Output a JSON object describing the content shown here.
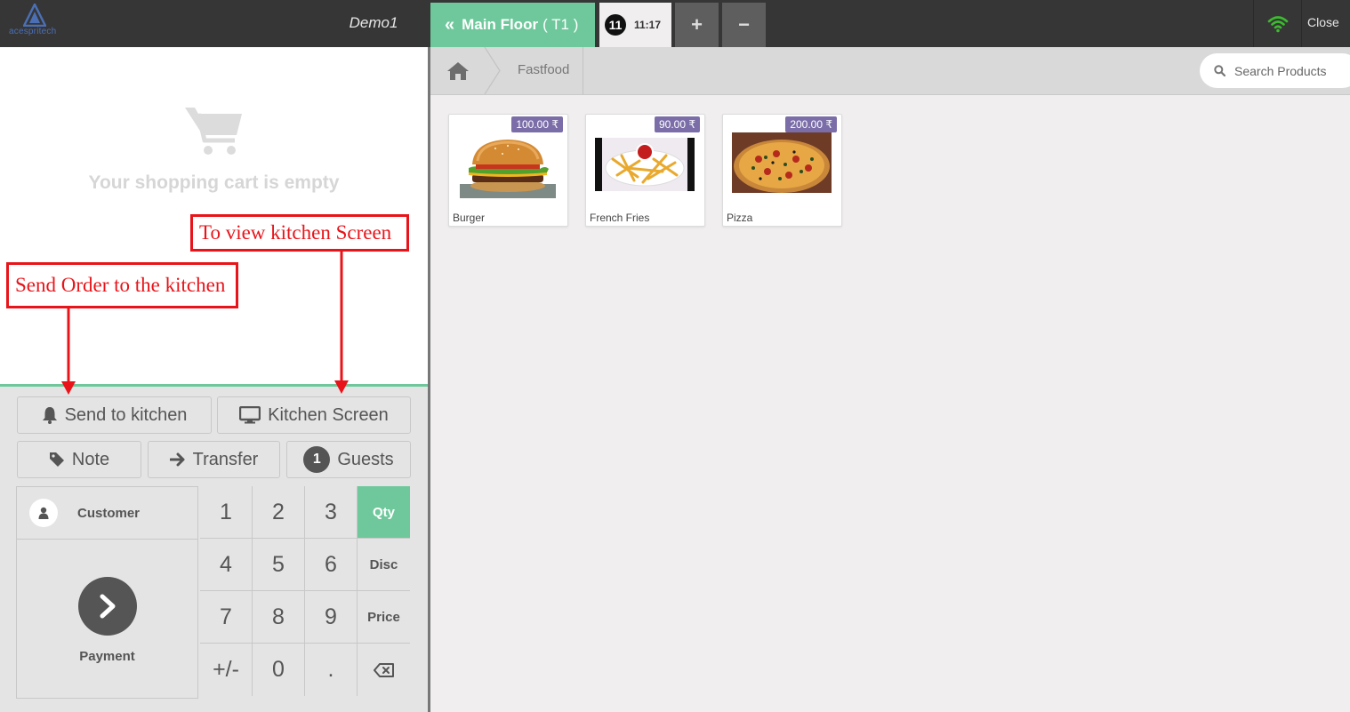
{
  "topbar": {
    "logo_text": "acespritech",
    "shop_name": "Demo1",
    "floor_label": "Main Floor",
    "table_label": "( T1 )",
    "order_number": "11",
    "order_time": "11:17",
    "plus_label": "+",
    "minus_label": "−",
    "close_label": "Close",
    "wifi_color": "#3cbb2f"
  },
  "cart": {
    "empty_text": "Your shopping cart is empty"
  },
  "controls": {
    "send_kitchen_label": "Send to kitchen",
    "kitchen_screen_label": "Kitchen Screen",
    "note_label": "Note",
    "transfer_label": "Transfer",
    "guests_count": "1",
    "guests_label": "Guests",
    "customer_label": "Customer",
    "payment_label": "Payment",
    "numpad": {
      "k1": "1",
      "k2": "2",
      "k3": "3",
      "k4": "4",
      "k5": "5",
      "k6": "6",
      "k7": "7",
      "k8": "8",
      "k9": "9",
      "sign": "+/-",
      "k0": "0",
      "dot": ".",
      "qty": "Qty",
      "disc": "Disc",
      "price": "Price",
      "active_mode": "Qty"
    }
  },
  "breadcrumb": {
    "category": "Fastfood"
  },
  "search": {
    "placeholder": "Search Products"
  },
  "products": [
    {
      "name": "Burger",
      "price": "100.00 ₹"
    },
    {
      "name": "French Fries",
      "price": "90.00 ₹"
    },
    {
      "name": "Pizza",
      "price": "200.00 ₹"
    }
  ],
  "annotations": {
    "kitchen_screen": "To view kitchen Screen",
    "send_kitchen": "Send Order to the kitchen"
  },
  "colors": {
    "accent_green": "#6ec89b",
    "price_badge": "#7b6ea8",
    "annotation_red": "#e8141a"
  }
}
